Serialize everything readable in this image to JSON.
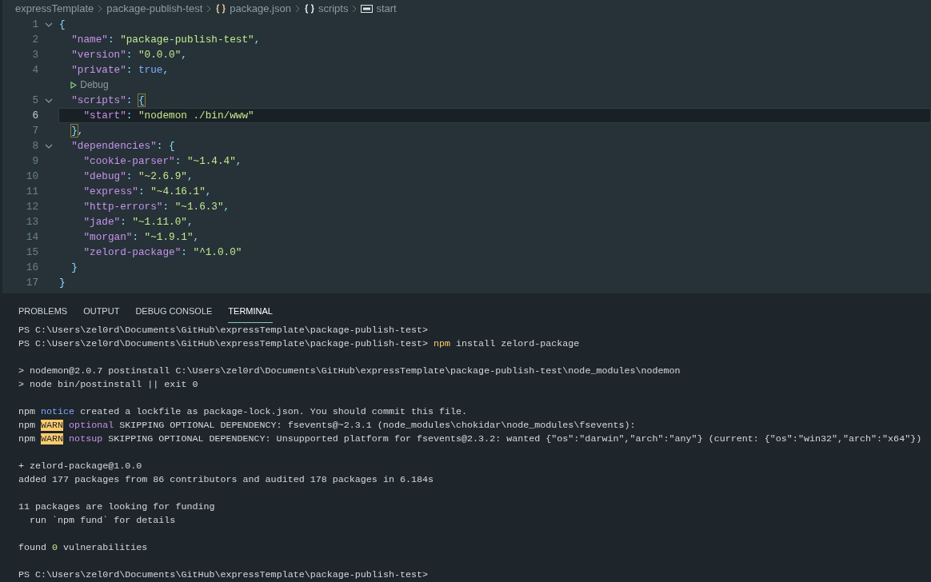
{
  "breadcrumb": [
    {
      "label": "expressTemplate",
      "kind": "folder"
    },
    {
      "label": "package-publish-test",
      "kind": "folder"
    },
    {
      "label": "package.json",
      "kind": "json-file"
    },
    {
      "label": "scripts",
      "kind": "object"
    },
    {
      "label": "start",
      "kind": "string"
    }
  ],
  "editor": {
    "lines": [
      {
        "number": "1",
        "current": false,
        "tokens": [
          {
            "kind": "punct",
            "text": "{"
          }
        ],
        "children": [
          {
            "number": "2",
            "current": false,
            "tokens": [
              {
                "kind": "key",
                "text": "\"name\""
              },
              {
                "kind": "punct",
                "text": ": "
              },
              {
                "kind": "string",
                "text": "\"package-publish-test\""
              },
              {
                "kind": "punct",
                "text": ","
              }
            ]
          },
          {
            "number": "3",
            "current": false,
            "tokens": [
              {
                "kind": "key",
                "text": "\"version\""
              },
              {
                "kind": "punct",
                "text": ": "
              },
              {
                "kind": "string",
                "text": "\"0.0.0\""
              },
              {
                "kind": "punct",
                "text": ","
              }
            ]
          },
          {
            "number": "4",
            "current": false,
            "tokens": [
              {
                "kind": "key",
                "text": "\"private\""
              },
              {
                "kind": "punct",
                "text": ": "
              },
              {
                "kind": "bool",
                "text": "true"
              },
              {
                "kind": "punct",
                "text": ","
              }
            ],
            "codelens": "Debug"
          },
          {
            "number": "5",
            "current": false,
            "tokens": [
              {
                "kind": "key",
                "text": "\"scripts\""
              },
              {
                "kind": "punct",
                "text": ": "
              },
              {
                "kind": "bracket",
                "text": "{"
              }
            ],
            "children": [
              {
                "number": "6",
                "current": true,
                "tokens": [
                  {
                    "kind": "key",
                    "text": "\"start\""
                  },
                  {
                    "kind": "punct",
                    "text": ": "
                  },
                  {
                    "kind": "string",
                    "text": "\"nodemon ./bin/www\""
                  }
                ]
              }
            ]
          },
          {
            "number": "7",
            "current": false,
            "tokens": [
              {
                "kind": "bracket",
                "text": "}"
              },
              {
                "kind": "punct",
                "text": ","
              }
            ]
          },
          {
            "number": "8",
            "current": false,
            "tokens": [
              {
                "kind": "key",
                "text": "\"dependencies\""
              },
              {
                "kind": "punct",
                "text": ": {"
              }
            ],
            "children": [
              {
                "number": "9",
                "current": false,
                "tokens": [
                  {
                    "kind": "key",
                    "text": "\"cookie-parser\""
                  },
                  {
                    "kind": "punct",
                    "text": ": "
                  },
                  {
                    "kind": "string",
                    "text": "\"~1.4.4\""
                  },
                  {
                    "kind": "punct",
                    "text": ","
                  }
                ]
              },
              {
                "number": "10",
                "current": false,
                "tokens": [
                  {
                    "kind": "key",
                    "text": "\"debug\""
                  },
                  {
                    "kind": "punct",
                    "text": ": "
                  },
                  {
                    "kind": "string",
                    "text": "\"~2.6.9\""
                  },
                  {
                    "kind": "punct",
                    "text": ","
                  }
                ]
              },
              {
                "number": "11",
                "current": false,
                "tokens": [
                  {
                    "kind": "key",
                    "text": "\"express\""
                  },
                  {
                    "kind": "punct",
                    "text": ": "
                  },
                  {
                    "kind": "string",
                    "text": "\"~4.16.1\""
                  },
                  {
                    "kind": "punct",
                    "text": ","
                  }
                ]
              },
              {
                "number": "12",
                "current": false,
                "tokens": [
                  {
                    "kind": "key",
                    "text": "\"http-errors\""
                  },
                  {
                    "kind": "punct",
                    "text": ": "
                  },
                  {
                    "kind": "string",
                    "text": "\"~1.6.3\""
                  },
                  {
                    "kind": "punct",
                    "text": ","
                  }
                ]
              },
              {
                "number": "13",
                "current": false,
                "tokens": [
                  {
                    "kind": "key",
                    "text": "\"jade\""
                  },
                  {
                    "kind": "punct",
                    "text": ": "
                  },
                  {
                    "kind": "string",
                    "text": "\"~1.11.0\""
                  },
                  {
                    "kind": "punct",
                    "text": ","
                  }
                ]
              },
              {
                "number": "14",
                "current": false,
                "tokens": [
                  {
                    "kind": "key",
                    "text": "\"morgan\""
                  },
                  {
                    "kind": "punct",
                    "text": ": "
                  },
                  {
                    "kind": "string",
                    "text": "\"~1.9.1\""
                  },
                  {
                    "kind": "punct",
                    "text": ","
                  }
                ]
              },
              {
                "number": "15",
                "current": false,
                "tokens": [
                  {
                    "kind": "key",
                    "text": "\"zelord-package\""
                  },
                  {
                    "kind": "punct",
                    "text": ": "
                  },
                  {
                    "kind": "string",
                    "text": "\"^1.0.0\""
                  }
                ]
              }
            ]
          },
          {
            "number": "16",
            "current": false,
            "tokens": [
              {
                "kind": "punct",
                "text": "}"
              }
            ]
          }
        ]
      },
      {
        "number": "17",
        "current": false,
        "tokens": [
          {
            "kind": "punct",
            "text": "}"
          }
        ]
      }
    ]
  },
  "panel_tabs": [
    {
      "label": "PROBLEMS",
      "selected": false
    },
    {
      "label": "OUTPUT",
      "selected": false
    },
    {
      "label": "DEBUG CONSOLE",
      "selected": false
    },
    {
      "label": "TERMINAL",
      "selected": true
    }
  ],
  "terminal": {
    "blocks": [
      [
        [
          {
            "kind": "plain",
            "text": "PS C:\\Users\\zel0rd\\Documents\\GitHub\\expressTemplate\\package-publish-test>"
          }
        ],
        [
          {
            "kind": "plain",
            "text": "PS C:\\Users\\zel0rd\\Documents\\GitHub\\expressTemplate\\package-publish-test>"
          },
          {
            "kind": "command",
            "text": "npm"
          },
          {
            "kind": "plain",
            "text": "install zelord-package"
          }
        ]
      ],
      [
        [
          {
            "kind": "plain",
            "text": "> nodemon@2.0.7 postinstall C:\\Users\\zel0rd\\Documents\\GitHub\\expressTemplate\\package-publish-test\\node_modules\\nodemon"
          }
        ],
        [
          {
            "kind": "plain",
            "text": "> node bin/postinstall || exit 0"
          }
        ]
      ],
      [
        [
          {
            "kind": "plain",
            "text": "npm"
          },
          {
            "kind": "notice",
            "text": "notice"
          },
          {
            "kind": "plain",
            "text": "created a lockfile as package-lock.json. You should commit this file."
          }
        ],
        [
          {
            "kind": "plain",
            "text": "npm"
          },
          {
            "kind": "warn",
            "text": "WARN"
          },
          {
            "kind": "tag",
            "text": "optional"
          },
          {
            "kind": "plain",
            "text": "SKIPPING OPTIONAL DEPENDENCY: fsevents@~2.3.1 (node_modules\\chokidar\\node_modules\\fsevents):"
          }
        ],
        [
          {
            "kind": "plain",
            "text": "npm"
          },
          {
            "kind": "warn",
            "text": "WARN"
          },
          {
            "kind": "tag",
            "text": "notsup"
          },
          {
            "kind": "plain",
            "text": "SKIPPING OPTIONAL DEPENDENCY: Unsupported platform for fsevents@2.3.2: wanted {\"os\":\"darwin\",\"arch\":\"any\"} (current: {\"os\":\"win32\",\"arch\":\"x64\"})"
          }
        ]
      ],
      [
        [
          {
            "kind": "plain",
            "text": "+ zelord-package@1.0.0"
          }
        ],
        [
          {
            "kind": "plain",
            "text": "added 177 packages from 86 contributors and audited 178 packages in 6.184s"
          }
        ]
      ],
      [
        [
          {
            "kind": "plain",
            "text": "11 packages are looking for funding"
          }
        ],
        [
          {
            "kind": "plain",
            "text": "run `npm fund` for details",
            "indented": true
          }
        ]
      ],
      [
        [
          {
            "kind": "plain",
            "text": "found"
          },
          {
            "kind": "number",
            "text": "0"
          },
          {
            "kind": "plain",
            "text": "vulnerabilities"
          }
        ]
      ],
      [
        [
          {
            "kind": "plain",
            "text": "PS C:\\Users\\zel0rd\\Documents\\GitHub\\expressTemplate\\package-publish-test>"
          }
        ]
      ]
    ]
  }
}
